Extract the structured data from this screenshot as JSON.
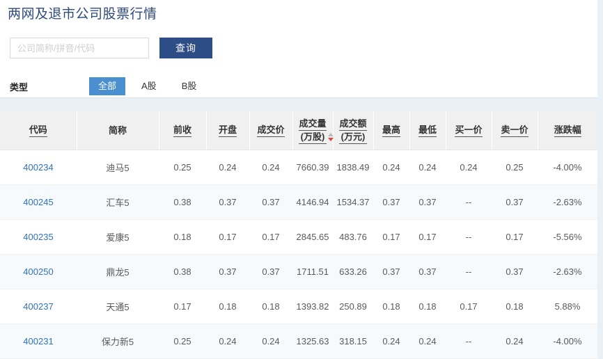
{
  "header": {
    "title": "两网及退市公司股票行情"
  },
  "search": {
    "placeholder": "公司简称/拼音/代码",
    "value": "",
    "query_label": "查询"
  },
  "filter": {
    "type_label": "类型",
    "tabs": [
      {
        "label": "全部",
        "active": true
      },
      {
        "label": "A股",
        "active": false
      },
      {
        "label": "B股",
        "active": false
      }
    ]
  },
  "table": {
    "columns": [
      {
        "label": "代码",
        "sortable": true,
        "sorted": "none"
      },
      {
        "label": "简称",
        "sortable": false,
        "sorted": "none"
      },
      {
        "label": "前收",
        "sortable": true,
        "sorted": "none"
      },
      {
        "label": "开盘",
        "sortable": true,
        "sorted": "none"
      },
      {
        "label": "成交价",
        "sortable": true,
        "sorted": "none"
      },
      {
        "label": "成交量(万股)",
        "line1": "成交量",
        "line2": "(万股)",
        "sortable": true,
        "sorted": "desc"
      },
      {
        "label": "成交额(万元)",
        "line1": "成交额",
        "line2": "(万元)",
        "sortable": true,
        "sorted": "none"
      },
      {
        "label": "最高",
        "sortable": true,
        "sorted": "none"
      },
      {
        "label": "最低",
        "sortable": true,
        "sorted": "none"
      },
      {
        "label": "买一价",
        "sortable": true,
        "sorted": "none"
      },
      {
        "label": "卖一价",
        "sortable": true,
        "sorted": "none"
      },
      {
        "label": "涨跌幅",
        "sortable": true,
        "sorted": "none"
      }
    ],
    "rows": [
      {
        "code": "400234",
        "name": "迪马5",
        "prev_close": "0.25",
        "open": "0.24",
        "price": "0.24",
        "volume": "7660.39",
        "amount": "1838.49",
        "high": "0.24",
        "low": "0.24",
        "bid1": "0.24",
        "ask1": "0.25",
        "change": "-4.00%",
        "change_dir": "down"
      },
      {
        "code": "400245",
        "name": "汇车5",
        "prev_close": "0.38",
        "open": "0.37",
        "price": "0.37",
        "volume": "4146.94",
        "amount": "1534.37",
        "high": "0.37",
        "low": "0.37",
        "bid1": "--",
        "ask1": "0.37",
        "change": "-2.63%",
        "change_dir": "down"
      },
      {
        "code": "400235",
        "name": "爱康5",
        "prev_close": "0.18",
        "open": "0.17",
        "price": "0.17",
        "volume": "2845.65",
        "amount": "483.76",
        "high": "0.17",
        "low": "0.17",
        "bid1": "--",
        "ask1": "0.17",
        "change": "-5.56%",
        "change_dir": "down"
      },
      {
        "code": "400250",
        "name": "鼎龙5",
        "prev_close": "0.38",
        "open": "0.37",
        "price": "0.37",
        "volume": "1711.51",
        "amount": "633.26",
        "high": "0.37",
        "low": "0.37",
        "bid1": "--",
        "ask1": "0.37",
        "change": "-2.63%",
        "change_dir": "down"
      },
      {
        "code": "400237",
        "name": "天通5",
        "prev_close": "0.17",
        "open": "0.18",
        "price": "0.18",
        "volume": "1393.82",
        "amount": "250.89",
        "high": "0.18",
        "low": "0.18",
        "bid1": "0.17",
        "ask1": "0.18",
        "change": "5.88%",
        "change_dir": "up"
      },
      {
        "code": "400231",
        "name": "保力新5",
        "prev_close": "0.25",
        "open": "0.24",
        "price": "0.24",
        "volume": "1325.63",
        "amount": "318.15",
        "high": "0.24",
        "low": "0.24",
        "bid1": "--",
        "ask1": "0.24",
        "change": "-4.00%",
        "change_dir": "down"
      }
    ]
  },
  "colors": {
    "title": "#2e4a7d",
    "query_button": "#2c4d86",
    "active_tab": "#4a90d0",
    "link": "#2f72c0",
    "down": "#0b9b2f",
    "up": "#e8212a",
    "page_bg": "#eaf1f6",
    "header_bg": "#f0f0f0",
    "sort_active": "#d94b3a"
  }
}
